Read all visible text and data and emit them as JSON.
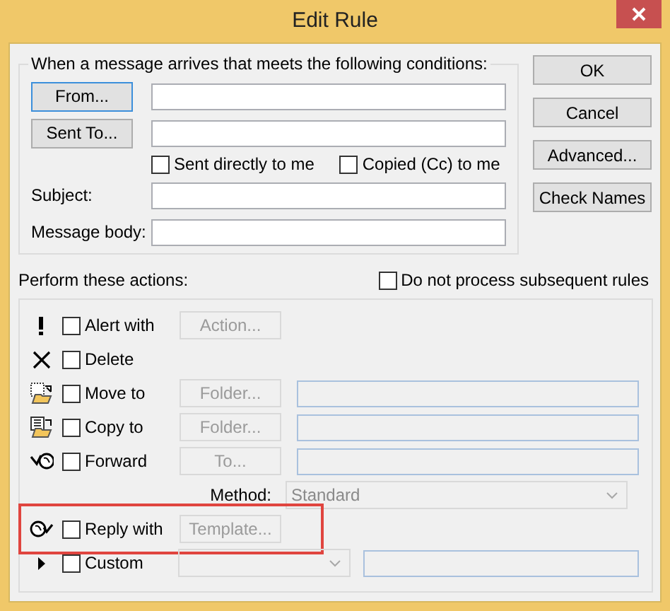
{
  "window": {
    "title": "Edit Rule"
  },
  "conditions": {
    "legend": "When a message arrives that meets the following conditions:",
    "rows": [
      {
        "kind": "button",
        "label": "From...",
        "focused": true
      },
      {
        "kind": "button",
        "label": "Sent To...",
        "focused": false
      },
      {
        "kind": "checks",
        "items": [
          {
            "label": "Sent directly to me",
            "checked": false
          },
          {
            "label": "Copied (Cc) to me",
            "checked": false
          }
        ]
      },
      {
        "kind": "label",
        "label": "Subject:"
      },
      {
        "kind": "label",
        "label": "Message body:"
      }
    ]
  },
  "buttons": [
    {
      "label": "OK"
    },
    {
      "label": "Cancel"
    },
    {
      "label": "Advanced..."
    },
    {
      "label": "Check Names"
    }
  ],
  "actions": {
    "title": "Perform these actions:",
    "stop": {
      "label": "Do not process subsequent rules",
      "checked": false
    },
    "rows": [
      {
        "kind": "action",
        "label": "Alert with",
        "checked": false,
        "button": "Action..."
      },
      {
        "kind": "action",
        "label": "Delete",
        "checked": false
      },
      {
        "kind": "action",
        "label": "Move to",
        "checked": false,
        "button": "Folder...",
        "field": true
      },
      {
        "kind": "action",
        "label": "Copy to",
        "checked": false,
        "button": "Folder...",
        "field": true
      },
      {
        "kind": "action",
        "label": "Forward",
        "checked": false,
        "button": "To...",
        "field": true
      },
      {
        "kind": "method",
        "label": "Method:",
        "value": "Standard"
      },
      {
        "kind": "action",
        "label": "Reply with",
        "checked": false,
        "button": "Template...",
        "highlighted": true
      },
      {
        "kind": "custom",
        "label": "Custom",
        "checked": false
      }
    ]
  }
}
